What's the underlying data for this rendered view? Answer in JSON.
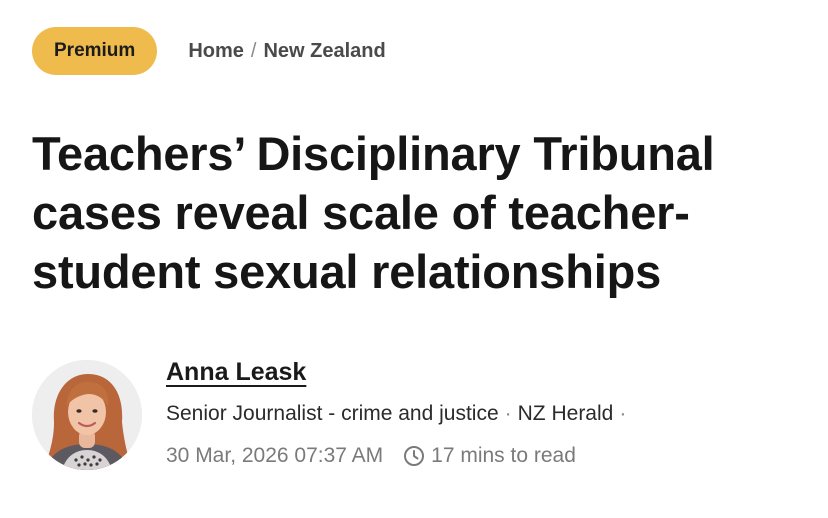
{
  "badge": {
    "label": "Premium",
    "color": "#efbb4c"
  },
  "breadcrumb": {
    "items": [
      {
        "label": "Home"
      },
      {
        "label": "New Zealand"
      }
    ],
    "separator": "/"
  },
  "article": {
    "headline": "Teachers’ Disciplinary Tribunal cases reveal scale of teacher-student sexual relationships"
  },
  "author": {
    "name": "Anna Leask",
    "role": "Senior Journalist - crime and justice",
    "outlet": "NZ Herald",
    "separator": "·",
    "avatar_icon": "author-photo"
  },
  "meta": {
    "published": "30 Mar, 2026 07:37 AM",
    "read_time": "17 mins to read",
    "read_time_icon": "clock-icon"
  }
}
